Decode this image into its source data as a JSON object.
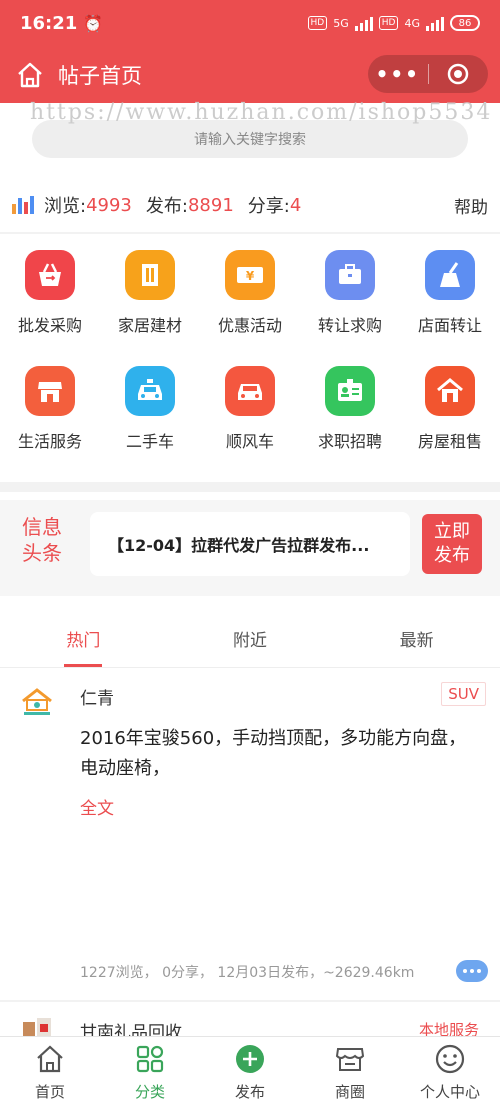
{
  "status": {
    "time": "16:21",
    "net1": "5G",
    "net2": "4G",
    "battery": "86"
  },
  "nav": {
    "title": "帖子首页"
  },
  "watermark": "https://www.huzhan.com/ishop5534",
  "search": {
    "placeholder": "请输入关键字搜索"
  },
  "stats": {
    "views_label": "浏览:",
    "views": "4993",
    "posts_label": "发布:",
    "posts": "8891",
    "shares_label": "分享:",
    "shares": "4",
    "help": "帮助"
  },
  "categories": [
    {
      "label": "批发采购",
      "icon": "basket-icon",
      "color": "#f0454a"
    },
    {
      "label": "家居建材",
      "icon": "building-icon",
      "color": "#f7a21b"
    },
    {
      "label": "优惠活动",
      "icon": "coupon-icon",
      "color": "#f99b1f"
    },
    {
      "label": "转让求购",
      "icon": "briefcase-icon",
      "color": "#6d8ef0"
    },
    {
      "label": "店面转让",
      "icon": "broom-icon",
      "color": "#5d8ef2"
    },
    {
      "label": "生活服务",
      "icon": "shop-icon",
      "color": "#f35f3d"
    },
    {
      "label": "二手车",
      "icon": "taxi-icon",
      "color": "#2fb1ec"
    },
    {
      "label": "顺风车",
      "icon": "car-icon",
      "color": "#f4573f"
    },
    {
      "label": "求职招聘",
      "icon": "id-card-icon",
      "color": "#35c55e"
    },
    {
      "label": "房屋租售",
      "icon": "house-icon",
      "color": "#f2552f"
    }
  ],
  "news": {
    "tag_line1": "信息",
    "tag_line2": "头条",
    "headline": "【12-04】拉群代发广告拉群发布...",
    "btn_line1": "立即",
    "btn_line2": "发布"
  },
  "tabs": [
    {
      "label": "热门"
    },
    {
      "label": "附近"
    },
    {
      "label": "最新"
    }
  ],
  "posts": [
    {
      "name": "仁青",
      "tag": "SUV",
      "body": "2016年宝骏560，手动挡顶配，多功能方向盘，电动座椅，",
      "more": "全文",
      "meta": "1227浏览，  0分享，  12月03日发布，~2629.46km"
    },
    {
      "name": "甘南礼品回收",
      "tag": "本地服务"
    }
  ],
  "tabbar": [
    {
      "label": "首页",
      "icon": "home-icon"
    },
    {
      "label": "分类",
      "icon": "grid-icon"
    },
    {
      "label": "发布",
      "icon": "plus-circle-icon"
    },
    {
      "label": "商圈",
      "icon": "store-icon"
    },
    {
      "label": "个人中心",
      "icon": "smiley-icon"
    }
  ],
  "colors": {
    "accent": "#eb4d4f",
    "tabbar_active": "#3aa55a"
  }
}
